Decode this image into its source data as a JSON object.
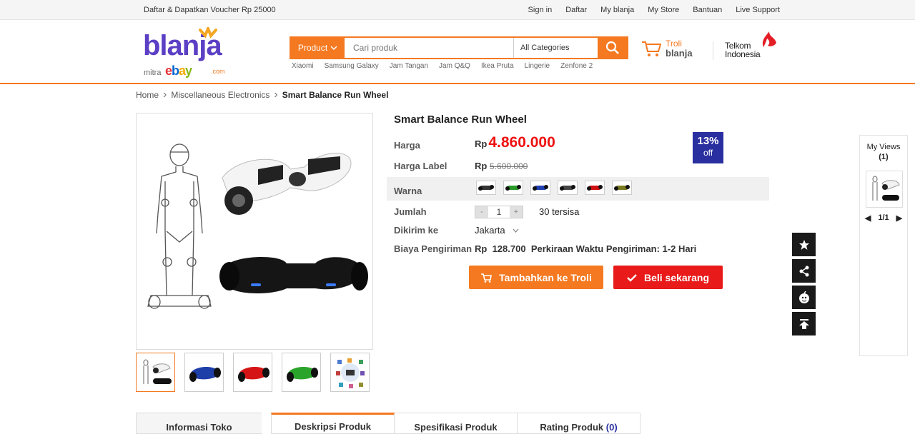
{
  "topbar": {
    "promo": "Daftar & Dapatkan Voucher Rp 25000",
    "links": [
      "Sign in",
      "Daftar",
      "My blanja",
      "My Store",
      "Bantuan",
      "Live Support"
    ]
  },
  "logo": {
    "word": "blanja",
    "mitra": "mitra",
    "ebay": "ebay",
    "dotcom": ".com"
  },
  "search": {
    "category_label": "Product",
    "placeholder": "Cari produk",
    "all_categories": "All Categories",
    "quick_links": [
      "Xiaomi",
      "Samsung Galaxy",
      "Jam Tangan",
      "Jam Q&Q",
      "Ikea Pruta",
      "Lingerie",
      "Zenfone 2"
    ]
  },
  "cart": {
    "line1": "Troli",
    "line2": "blanja"
  },
  "telkom": {
    "line1": "Telkom",
    "line2": "Indonesia"
  },
  "breadcrumb": [
    "Home",
    "Miscellaneous Electronics",
    "Smart Balance Run Wheel"
  ],
  "product": {
    "title": "Smart Balance Run Wheel",
    "price_label": "Harga",
    "currency": "Rp",
    "price": "4.860.000",
    "list_label": "Harga Label",
    "list_price": "5.600.000",
    "discount": "13%",
    "discount_off": "off",
    "color_label": "Warna",
    "swatch_colors": [
      "#333333",
      "#2a9a2a",
      "#1f3fb0",
      "#444444",
      "#d01010",
      "#7a7a20"
    ],
    "qty_label": "Jumlah",
    "qty_minus": "-",
    "qty": "1",
    "qty_plus": "+",
    "stock": "30 tersisa",
    "ship_label": "Dikirim ke",
    "ship_to": "Jakarta",
    "cost_label": "Biaya Pengiriman",
    "cost_currency": "Rp",
    "cost": "128.700",
    "eta": "Perkiraan Waktu Pengiriman: 1-2 Hari",
    "add_cart": "Tambahkan ke Troli",
    "buy_now": "Beli sekarang"
  },
  "views": {
    "title": "My Views",
    "count": "(1)",
    "page": "1/1"
  },
  "tabs": {
    "store_info": "Informasi Toko",
    "desc": "Deskripsi Produk",
    "spec": "Spesifikasi Produk",
    "rating": "Rating Produk",
    "rating_count": "(0)"
  }
}
